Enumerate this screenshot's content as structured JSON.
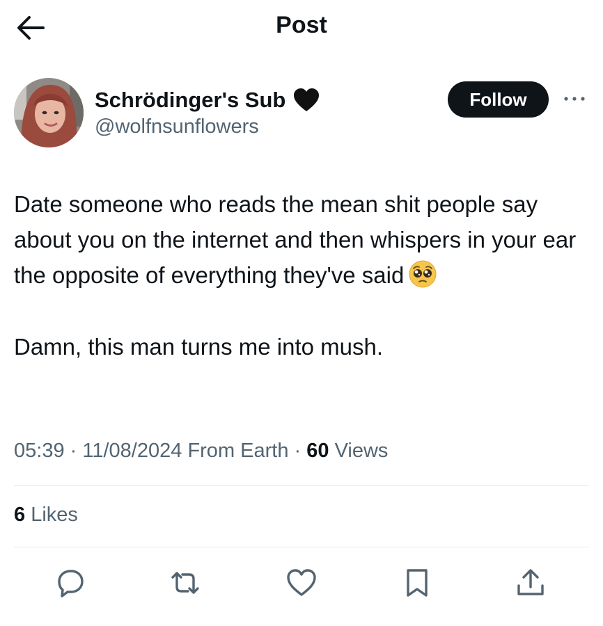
{
  "header": {
    "title": "Post"
  },
  "author": {
    "display_name": "Schrödinger's Sub",
    "handle": "@wolfnsunflowers",
    "badge_icon": "black-heart-icon",
    "follow_label": "Follow"
  },
  "post": {
    "paragraph1": "Date someone who reads the mean shit people say about you on the internet and then whispers in your ear the opposite of everything they've said",
    "paragraph1_emoji": "pleading-face-emoji",
    "paragraph2": "Damn, this man turns me into mush."
  },
  "meta": {
    "time": "05:39",
    "date": "11/08/2024",
    "source": "From Earth",
    "views_count": "60",
    "views_label": "Views",
    "separator": "·"
  },
  "stats": {
    "likes_count": "6",
    "likes_label": "Likes"
  },
  "actions": [
    {
      "icon": "reply-icon"
    },
    {
      "icon": "repost-icon"
    },
    {
      "icon": "like-icon"
    },
    {
      "icon": "bookmark-icon"
    },
    {
      "icon": "share-icon"
    }
  ],
  "colors": {
    "text": "#0f1419",
    "secondary": "#536471",
    "divider": "#e1e6ea",
    "button": "#0f1419"
  }
}
